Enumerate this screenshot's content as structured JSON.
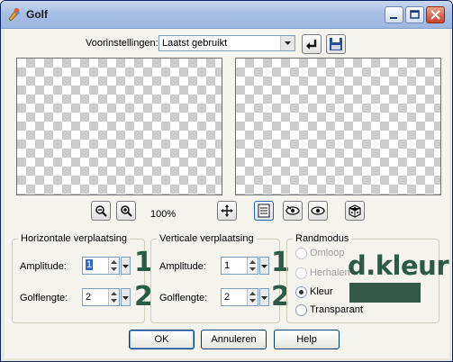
{
  "window": {
    "title": "Golf",
    "icon": "brush-icon"
  },
  "presets": {
    "label": "Voorinstellingen:",
    "value": "Laatst gebruikt"
  },
  "preview": {
    "zoom": "100%"
  },
  "horizontal": {
    "title": "Horizontale verplaatsing",
    "amplitude_label": "Amplitude:",
    "amplitude_value": "1",
    "wavelength_label": "Golflengte:",
    "wavelength_value": "2"
  },
  "vertical": {
    "title": "Verticale verplaatsing",
    "amplitude_label": "Amplitude:",
    "amplitude_value": "1",
    "wavelength_label": "Golflengte:",
    "wavelength_value": "2"
  },
  "edge_mode": {
    "title": "Randmodus",
    "options": [
      {
        "label": "Omloop",
        "enabled": false,
        "selected": false
      },
      {
        "label": "Herhalen",
        "enabled": false,
        "selected": false
      },
      {
        "label": "Kleur",
        "enabled": true,
        "selected": true
      },
      {
        "label": "Transparant",
        "enabled": true,
        "selected": false
      }
    ],
    "color": "#345748"
  },
  "annotations": {
    "num_1": "1",
    "num_2": "2",
    "num_1b": "1",
    "num_2b": "2",
    "color_note": "d.kleur",
    "color": "#2b5a47"
  },
  "buttons": {
    "ok": "OK",
    "cancel": "Annuleren",
    "help": "Help"
  }
}
